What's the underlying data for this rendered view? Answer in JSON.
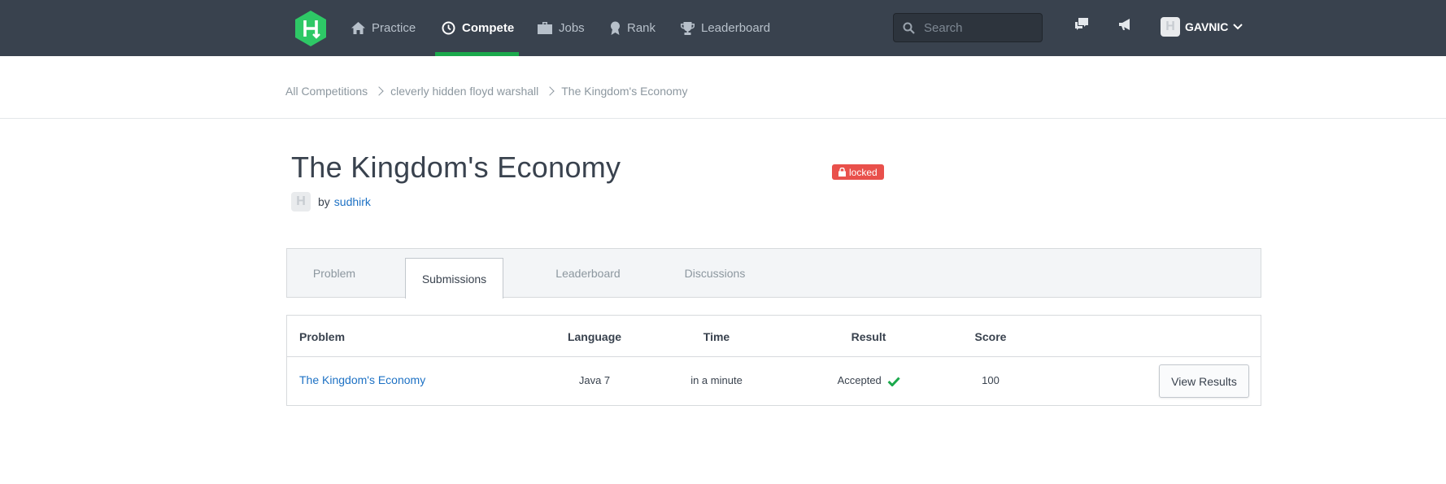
{
  "nav": {
    "items": [
      {
        "label": "Practice",
        "icon": "home-icon"
      },
      {
        "label": "Compete",
        "icon": "clock-icon"
      },
      {
        "label": "Jobs",
        "icon": "briefcase-icon"
      },
      {
        "label": "Rank",
        "icon": "medal-icon"
      },
      {
        "label": "Leaderboard",
        "icon": "trophy-icon"
      }
    ],
    "active": "Compete",
    "search_placeholder": "Search",
    "username": "GAVNIC",
    "accent_color": "#1ba94c"
  },
  "breadcrumb": {
    "items": [
      "All Competitions",
      "cleverly hidden floyd warshall"
    ],
    "current": "The Kingdom's Economy"
  },
  "challenge": {
    "title": "The Kingdom's Economy",
    "status_badge": "locked",
    "by_label": "by",
    "author": "sudhirk"
  },
  "tabs": [
    "Problem",
    "Submissions",
    "Leaderboard",
    "Discussions"
  ],
  "active_tab": "Submissions",
  "table": {
    "headers": [
      "Problem",
      "Language",
      "Time",
      "Result",
      "Score"
    ],
    "rows": [
      {
        "problem": "The Kingdom's Economy",
        "language": "Java 7",
        "time": "in a minute",
        "result": "Accepted",
        "score": "100",
        "action": "View Results"
      }
    ]
  }
}
